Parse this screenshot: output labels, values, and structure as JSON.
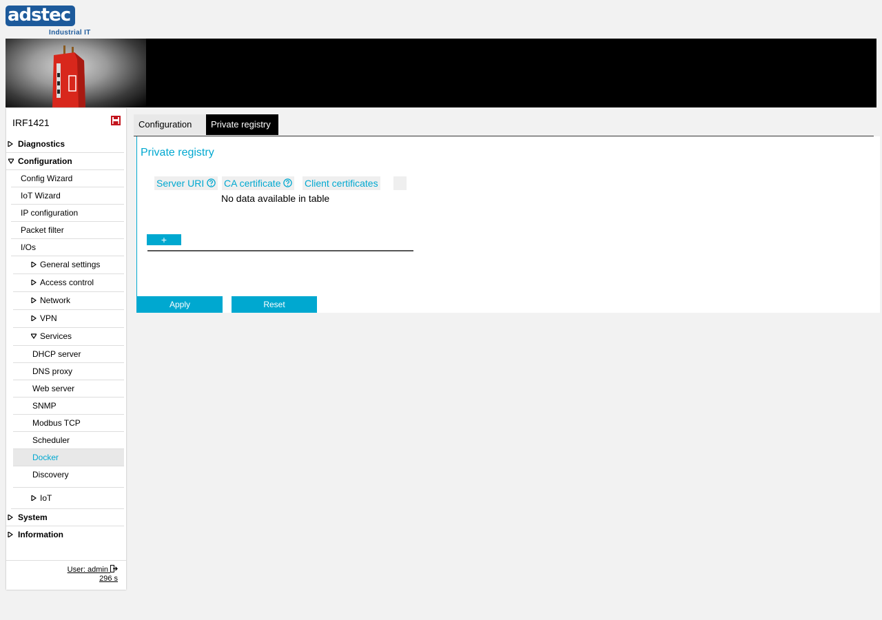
{
  "brand": {
    "logo_text_a": "ads",
    "logo_text_b": "tec",
    "logo_sub": "Industrial IT",
    "accent_color": "#00a8d0",
    "brand_color": "#1d5a9b"
  },
  "sidebar": {
    "device_name": "IRF1421",
    "items": [
      {
        "label": "Diagnostics",
        "level": 0,
        "expanded": false,
        "bold": true
      },
      {
        "label": "Configuration",
        "level": 0,
        "expanded": true,
        "bold": true
      },
      {
        "label": "Config Wizard",
        "level": 1
      },
      {
        "label": "IoT Wizard",
        "level": 1
      },
      {
        "label": "IP configuration",
        "level": 1
      },
      {
        "label": "Packet filter",
        "level": 1
      },
      {
        "label": "I/Os",
        "level": 1
      },
      {
        "label": "General settings",
        "level": 2,
        "expanded": false
      },
      {
        "label": "Access control",
        "level": 2,
        "expanded": false
      },
      {
        "label": "Network",
        "level": 2,
        "expanded": false
      },
      {
        "label": "VPN",
        "level": 2,
        "expanded": false
      },
      {
        "label": "Services",
        "level": 2,
        "expanded": true
      },
      {
        "label": "DHCP server",
        "level": 3
      },
      {
        "label": "DNS proxy",
        "level": 3
      },
      {
        "label": "Web server",
        "level": 3
      },
      {
        "label": "SNMP",
        "level": 3
      },
      {
        "label": "Modbus TCP",
        "level": 3
      },
      {
        "label": "Scheduler",
        "level": 3
      },
      {
        "label": "Docker",
        "level": 3,
        "active": true
      },
      {
        "label": "Discovery",
        "level": 3
      },
      {
        "label": "IoT",
        "level": 2,
        "expanded": false
      },
      {
        "label": "System",
        "level": 0,
        "expanded": false,
        "bold": true
      },
      {
        "label": "Information",
        "level": 0,
        "expanded": false,
        "bold": true
      }
    ],
    "user_label": "User: admin",
    "session_timer": "296 s"
  },
  "tabs": [
    {
      "label": "Configuration",
      "active": false
    },
    {
      "label": "Private registry",
      "active": true
    }
  ],
  "main": {
    "title": "Private registry",
    "columns": [
      "Server URI",
      "CA certificate",
      "Client certificates"
    ],
    "empty_message": "No data available in table",
    "add_label": "+",
    "apply_label": "Apply",
    "reset_label": "Reset"
  }
}
